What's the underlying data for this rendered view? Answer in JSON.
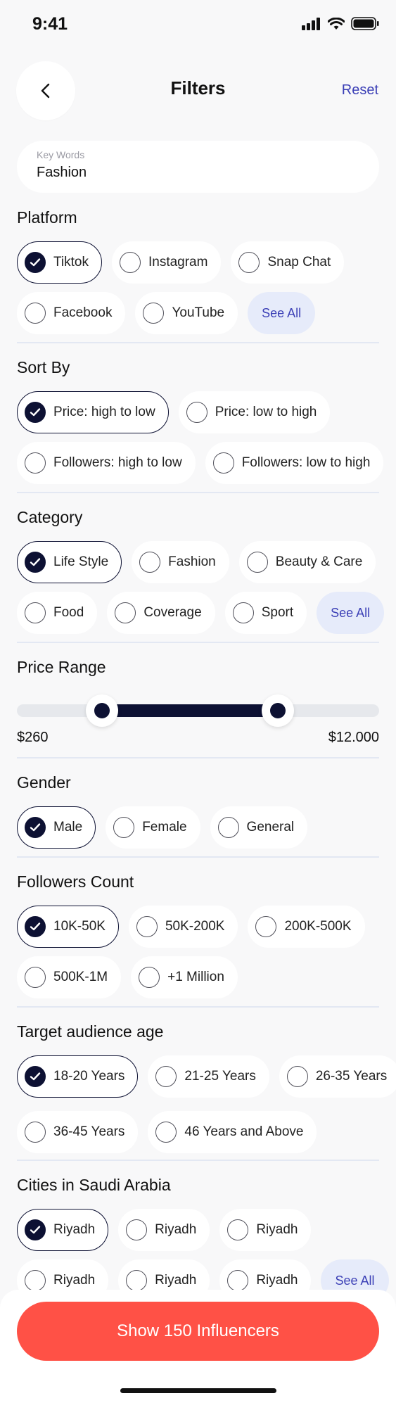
{
  "status": {
    "time": "9:41"
  },
  "header": {
    "title": "Filters",
    "reset": "Reset"
  },
  "search": {
    "label": "Key Words",
    "value": "Fashion"
  },
  "see_all": "See All",
  "platform": {
    "title": "Platform",
    "row1": [
      {
        "label": "Tiktok",
        "selected": true
      },
      {
        "label": "Instagram",
        "selected": false
      },
      {
        "label": "Snap Chat",
        "selected": false
      }
    ],
    "row2": [
      {
        "label": "Facebook",
        "selected": false
      },
      {
        "label": "YouTube",
        "selected": false
      }
    ]
  },
  "sort_by": {
    "title": "Sort By",
    "row1": [
      {
        "label": "Price: high to low",
        "selected": true
      },
      {
        "label": "Price: low to high",
        "selected": false
      }
    ],
    "row2": [
      {
        "label": "Followers: high to low",
        "selected": false
      },
      {
        "label": "Followers: low to high",
        "selected": false
      }
    ]
  },
  "category": {
    "title": "Category",
    "row1": [
      {
        "label": "Life Style",
        "selected": true
      },
      {
        "label": "Fashion",
        "selected": false
      },
      {
        "label": "Beauty & Care",
        "selected": false
      }
    ],
    "row2": [
      {
        "label": "Food",
        "selected": false
      },
      {
        "label": "Coverage",
        "selected": false
      },
      {
        "label": "Sport",
        "selected": false
      }
    ]
  },
  "price_range": {
    "title": "Price Range",
    "min_label": "$260",
    "max_label": "$12.000",
    "low_fraction": 0.235,
    "high_fraction": 0.72
  },
  "gender": {
    "title": "Gender",
    "row1": [
      {
        "label": "Male",
        "selected": true
      },
      {
        "label": "Female",
        "selected": false
      },
      {
        "label": "General",
        "selected": false
      }
    ]
  },
  "followers": {
    "title": "Followers Count",
    "row1": [
      {
        "label": "10K-50K",
        "selected": true
      },
      {
        "label": "50K-200K",
        "selected": false
      },
      {
        "label": "200K-500K",
        "selected": false
      }
    ],
    "row2": [
      {
        "label": "500K-1M",
        "selected": false
      },
      {
        "label": "+1 Million",
        "selected": false
      }
    ]
  },
  "age": {
    "title": "Target audience age",
    "row1": [
      {
        "label": "18-20 Years",
        "selected": true
      },
      {
        "label": "21-25 Years",
        "selected": false
      },
      {
        "label": "26-35 Years",
        "selected": false
      }
    ],
    "row2": [
      {
        "label": "36-45 Years",
        "selected": false
      },
      {
        "label": "46 Years and Above",
        "selected": false
      }
    ]
  },
  "cities": {
    "title": "Cities in Saudi Arabia",
    "row1": [
      {
        "label": "Riyadh",
        "selected": true
      },
      {
        "label": "Riyadh",
        "selected": false
      },
      {
        "label": "Riyadh",
        "selected": false
      }
    ],
    "row2": [
      {
        "label": "Riyadh",
        "selected": false
      },
      {
        "label": "Riyadh",
        "selected": false
      },
      {
        "label": "Riyadh",
        "selected": false
      }
    ]
  },
  "cta": {
    "label": "Show 150 Influencers"
  },
  "colors": {
    "primary": "#0d1133",
    "accent": "#ff5146",
    "link": "#3b3fb6",
    "see_all_bg": "#e6ebfa"
  },
  "icons": {
    "back": "chevron-left-icon",
    "check": "check-icon",
    "signal": "signal-icon",
    "wifi": "wifi-icon",
    "battery": "battery-icon"
  }
}
